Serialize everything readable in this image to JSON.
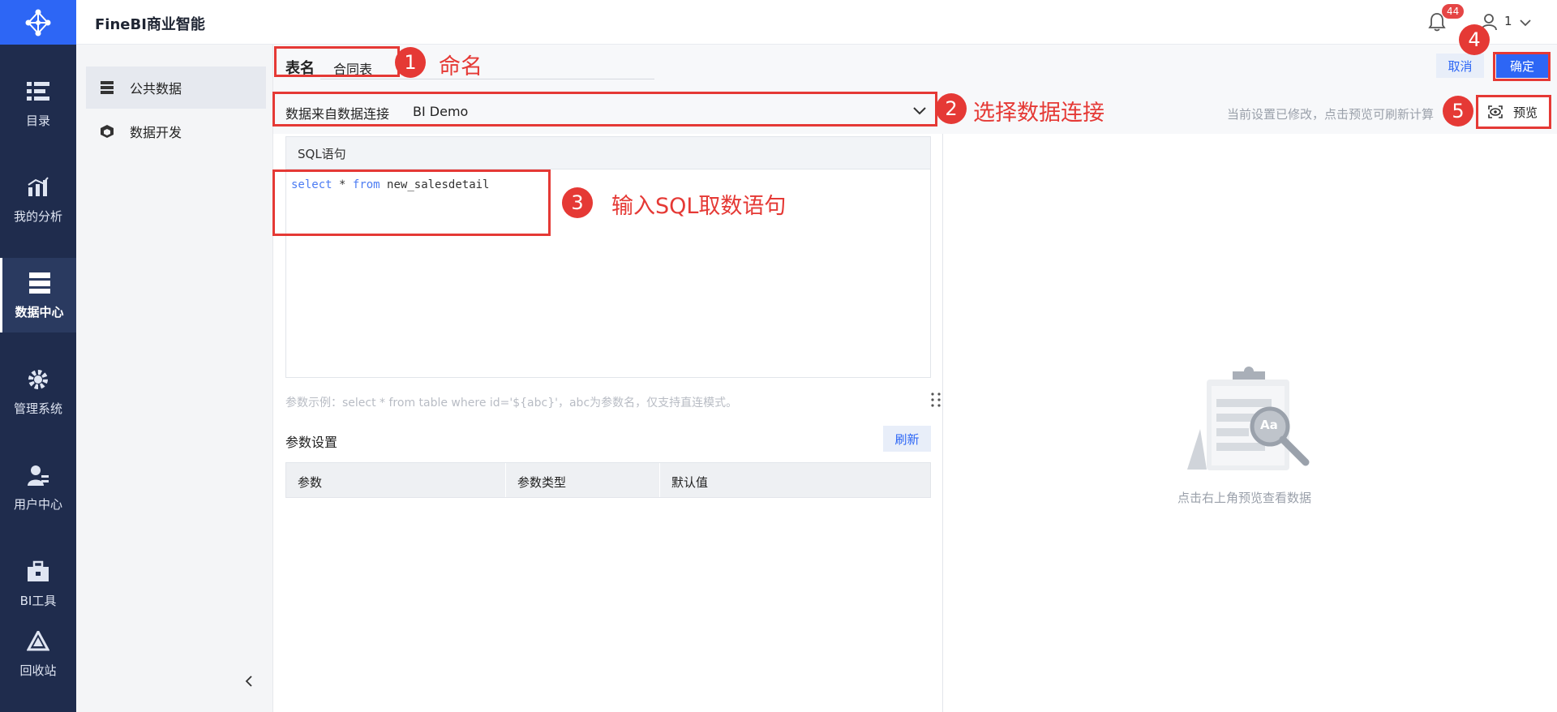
{
  "app": {
    "title": "FineBI商业智能"
  },
  "header": {
    "notifications_count": "44",
    "user_label": "1"
  },
  "rail": {
    "items": [
      {
        "label": "目录",
        "icon": "catalog-icon"
      },
      {
        "label": "我的分析",
        "icon": "analysis-icon"
      },
      {
        "label": "数据中心",
        "icon": "data-center-icon"
      },
      {
        "label": "管理系统",
        "icon": "gear-icon"
      },
      {
        "label": "用户中心",
        "icon": "user-icon"
      },
      {
        "label": "BI工具",
        "icon": "toolbox-icon"
      },
      {
        "label": "回收站",
        "icon": "recycle-icon"
      }
    ]
  },
  "subnav": {
    "items": [
      {
        "label": "公共数据"
      },
      {
        "label": "数据开发"
      }
    ]
  },
  "editor": {
    "name_label": "表名",
    "name_value": "合同表",
    "connection_label": "数据来自数据连接",
    "connection_value": "BI Demo",
    "sql_header": "SQL语句",
    "sql_kw_select": "select",
    "sql_star": "*",
    "sql_kw_from": "from",
    "sql_table": "new_salesdetail",
    "hint": "参数示例：select * from table where id='${abc}'，abc为参数名，仅支持直连模式。",
    "param_title": "参数设置",
    "refresh_label": "刷新",
    "param_headers": [
      "参数",
      "参数类型",
      "默认值"
    ]
  },
  "actions": {
    "cancel_label": "取消",
    "confirm_label": "确定",
    "preview_label": "预览"
  },
  "preview": {
    "status_text": "当前设置已修改，点击预览可刷新计算",
    "empty_text": "点击右上角预览查看数据",
    "empty_icon_text": "Aa"
  },
  "annotations": [
    {
      "num": "1",
      "text": "命名"
    },
    {
      "num": "2",
      "text": "选择数据连接"
    },
    {
      "num": "3",
      "text": "输入SQL取数语句"
    },
    {
      "num": "4",
      "text": ""
    },
    {
      "num": "5",
      "text": ""
    }
  ],
  "colors": {
    "rail_bg": "#1f2c4d",
    "accent": "#2d66f5",
    "annotation_red": "#e53935"
  }
}
